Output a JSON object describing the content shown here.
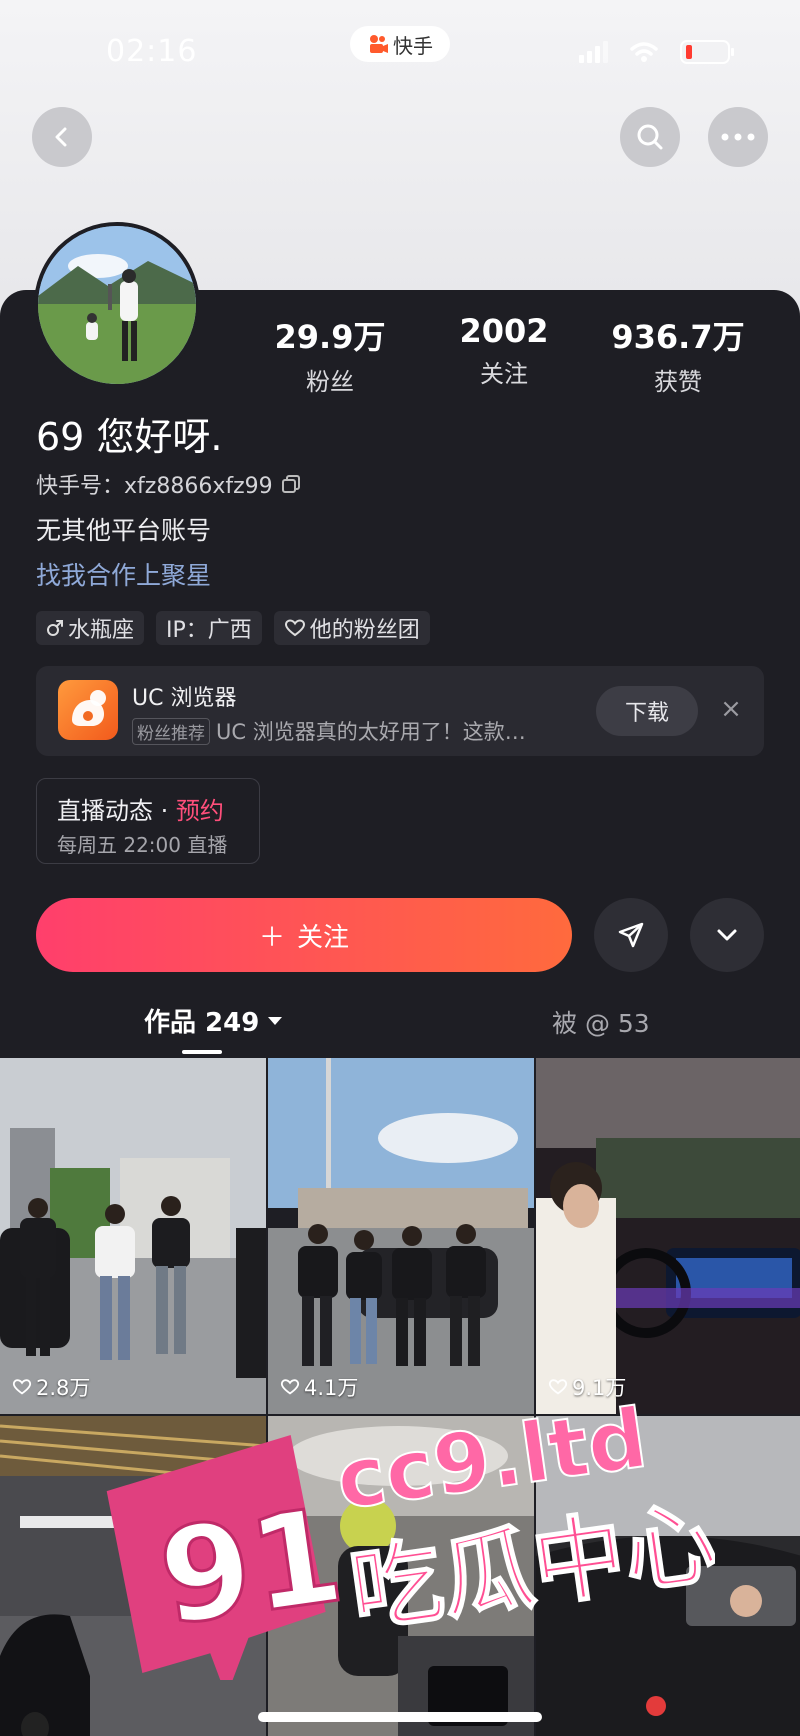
{
  "status_bar": {
    "time": "02:16",
    "app_name": "快手"
  },
  "profile": {
    "name": "69 您好呀.",
    "kuaishou_id_label": "快手号：",
    "kuaishou_id": "xfz8866xfz99",
    "bio_line": "无其他平台账号",
    "bio_link": "找我合作上聚星",
    "stats": [
      {
        "value": "29.9万",
        "label": "粉丝"
      },
      {
        "value": "2002",
        "label": "关注"
      },
      {
        "value": "936.7万",
        "label": "获赞"
      }
    ],
    "tags": [
      {
        "label": "水瓶座",
        "icon": "male-icon"
      },
      {
        "label": "IP：广西",
        "icon": ""
      },
      {
        "label": "他的粉丝团",
        "icon": "heart-outline-icon"
      }
    ]
  },
  "ad": {
    "title": "UC 浏览器",
    "badge": "粉丝推荐",
    "text": "UC 浏览器真的太好用了！这款…",
    "download_label": "下载",
    "close": "×"
  },
  "live": {
    "title": "直播动态",
    "separator": " · ",
    "action": "预约",
    "schedule": "每周五 22:00 直播"
  },
  "actions": {
    "follow_label": "关注",
    "follow_plus": "＋"
  },
  "tabs": [
    {
      "label": "作品 249",
      "active": true
    },
    {
      "label": "被 @ 53",
      "active": false
    }
  ],
  "videos": [
    {
      "likes": "2.8万"
    },
    {
      "likes": "4.1万"
    },
    {
      "likes": "9.1万"
    },
    {
      "likes": ""
    },
    {
      "likes": ""
    },
    {
      "likes": ""
    }
  ],
  "watermark": {
    "badge": "91",
    "line1": "cc9.ltd",
    "line2": "吃瓜中心"
  },
  "colors": {
    "accent": "#ff4f7b",
    "follow_start": "#ff3f6c",
    "follow_end": "#ff6a3d",
    "link": "#8fa9d8"
  }
}
